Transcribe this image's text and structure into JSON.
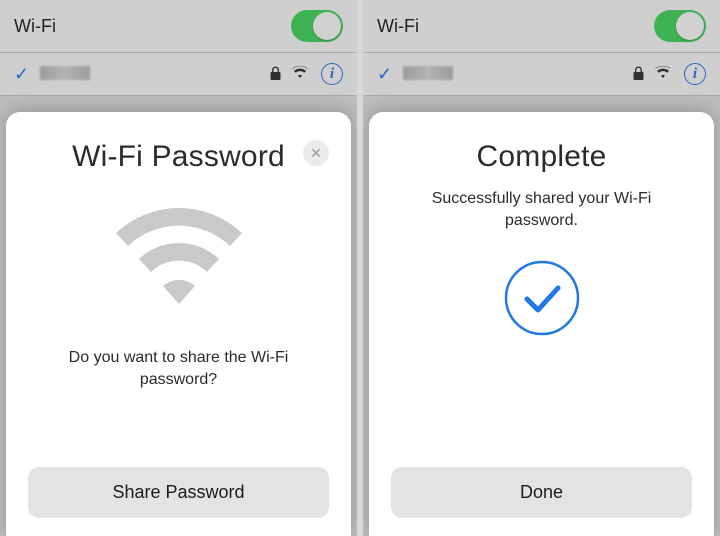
{
  "left": {
    "settings": {
      "wifi_label": "Wi-Fi",
      "toggle_on": true
    },
    "sheet": {
      "title": "Wi-Fi Password",
      "body": "Do you want to share the Wi-Fi password?",
      "button_label": "Share Password"
    }
  },
  "right": {
    "settings": {
      "wifi_label": "Wi-Fi",
      "toggle_on": true
    },
    "sheet": {
      "title": "Complete",
      "body": "Successfully shared your Wi-Fi password.",
      "button_label": "Done"
    }
  },
  "icons": {
    "info_glyph": "i",
    "close_glyph": "✕"
  }
}
